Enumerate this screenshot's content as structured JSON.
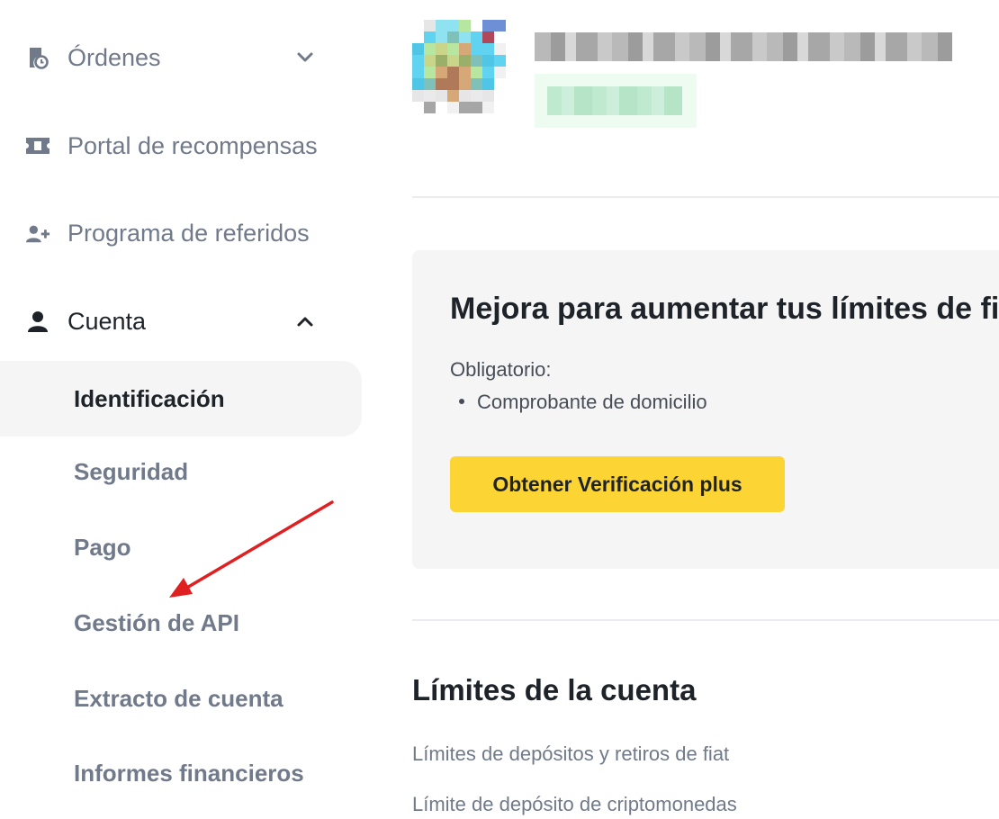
{
  "sidebar": {
    "items": [
      {
        "label": "Órdenes",
        "icon": "orders-clock-icon",
        "chevron": "chevron-down-icon"
      },
      {
        "label": "Portal de recompensas",
        "icon": "ticket-icon"
      },
      {
        "label": "Programa de referidos",
        "icon": "add-user-icon"
      },
      {
        "label": "Cuenta",
        "icon": "user-icon",
        "chevron": "chevron-up-icon"
      }
    ],
    "account_subitems": [
      {
        "label": "Identificación",
        "selected": true
      },
      {
        "label": "Seguridad"
      },
      {
        "label": "Pago"
      },
      {
        "label": "Gestión de API"
      },
      {
        "label": "Extracto de cuenta"
      },
      {
        "label": "Informes financieros"
      }
    ]
  },
  "annotation": {
    "type": "red-arrow",
    "color": "#e02020",
    "points_to": "Gestión de API"
  },
  "main": {
    "profile": {
      "avatar": "pixelated-avatar",
      "name": "",
      "badge": ""
    },
    "upgrade_card": {
      "title": "Mejora para aumentar tus límites de fiat",
      "required_label": "Obligatorio:",
      "requirement": "Comprobante de domicilio",
      "button_label": "Obtener Verificación plus",
      "button_color": "#fcd535"
    },
    "limits": {
      "title": "Límites de la cuenta",
      "links": [
        "Límites de depósitos y retiros de fiat",
        "Límite de depósito de criptomonedas"
      ]
    }
  },
  "colors": {
    "text_primary": "#1e2329",
    "text_secondary": "#707a8a",
    "accent": "#fcd535",
    "card_bg": "#f5f5f5"
  }
}
